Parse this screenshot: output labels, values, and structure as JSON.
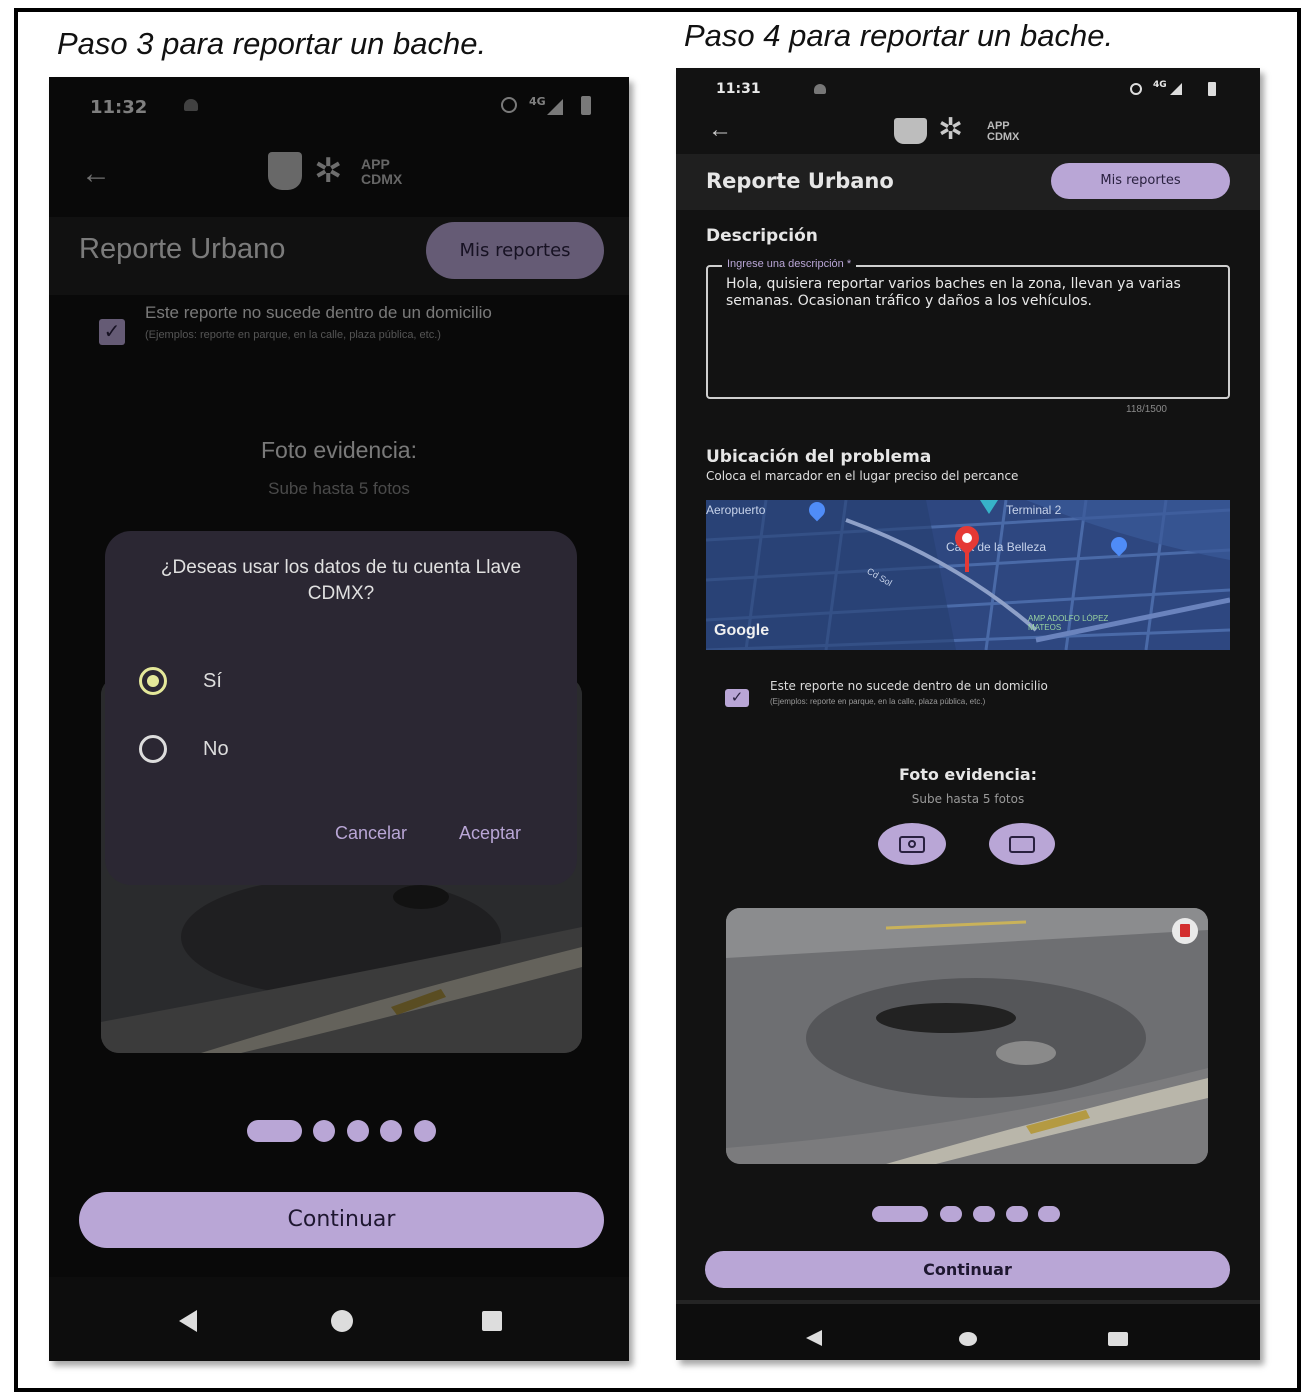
{
  "left": {
    "caption": "Paso 3 para reportar un bache.",
    "status_time": "11:32",
    "status_network": "4G",
    "logo_text_1": "APP",
    "logo_text_2": "CDMX",
    "title": "Reporte Urbano",
    "my_reports_button": "Mis reportes",
    "checkbox_label": "Este reporte no sucede dentro de un domicilio",
    "checkbox_hint": "(Ejemplos: reporte en parque, en la calle, plaza pública, etc.)",
    "photo_title": "Foto evidencia:",
    "photo_subtitle": "Sube hasta 5 fotos",
    "dialog": {
      "question": "¿Deseas usar los datos de tu cuenta Llave CDMX?",
      "options": [
        "Sí",
        "No"
      ],
      "selected": "Sí",
      "cancel": "Cancelar",
      "accept": "Aceptar"
    },
    "continue_button": "Continuar",
    "pager_active_index": 0
  },
  "right": {
    "caption": "Paso 4 para reportar un bache.",
    "status_time": "11:31",
    "status_network": "4G",
    "logo_text_1": "APP",
    "logo_text_2": "CDMX",
    "title": "Reporte Urbano",
    "my_reports_button": "Mis reportes",
    "description_label": "Descripción",
    "description_placeholder": "Ingrese una descripción *",
    "description_value": "Hola, quisiera reportar varios baches en la zona, llevan ya varias semanas. Ocasionan tráfico y daños a los vehículos.",
    "char_count": "118/1500",
    "location_title": "Ubicación del problema",
    "location_subtitle": "Coloca el marcador en el lugar preciso del percance",
    "map_labels": {
      "airport": "Aeropuerto",
      "terminal": "Terminal 2",
      "place": "Casa de la Belleza",
      "street": "Cd Sol",
      "neighborhood": "AMP ADOLFO LÓPEZ MATEOS",
      "google": "Google"
    },
    "checkbox_label": "Este reporte no sucede dentro de un domicilio",
    "checkbox_hint": "(Ejemplos: reporte en parque, en la calle, plaza pública, etc.)",
    "photo_title": "Foto evidencia:",
    "photo_subtitle": "Sube hasta 5 fotos",
    "continue_button": "Continuar",
    "pager_active_index": 0
  },
  "colors": {
    "accent": "#b9a6d6",
    "background": "#121212",
    "dialog": "#2b2733",
    "radio_selected": "#e4e89a",
    "delete_red": "#d32f2f"
  }
}
